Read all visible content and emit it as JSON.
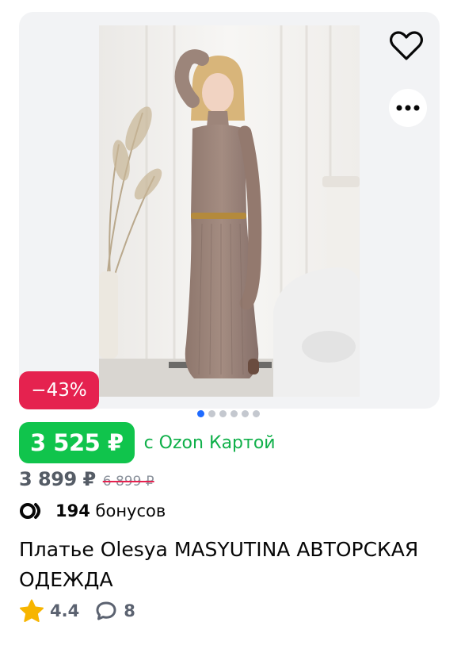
{
  "product": {
    "discount_badge": "−43%",
    "carousel": {
      "total": 6,
      "active": 0
    },
    "price_card": "3 525 ₽",
    "price_card_note": "с Ozon Картой",
    "price": "3 899 ₽",
    "price_original": "6 899 ₽",
    "bonus_amount": "194",
    "bonus_label": "бонусов",
    "title": "Платье Olesya MASYUTINA АВТОРСКАЯ ОДЕЖДА",
    "rating": "4.4",
    "reviews": "8"
  },
  "icons": {
    "favorite": "heart-icon",
    "more": "more-icon",
    "bonus": "bonus-icon",
    "rating": "star-icon",
    "reviews": "comment-icon"
  },
  "colors": {
    "discount": "#e5224f",
    "price_card": "#10c44c",
    "card_note": "#10b04a",
    "dot_active": "#1f6bff",
    "star": "#f7b500"
  }
}
